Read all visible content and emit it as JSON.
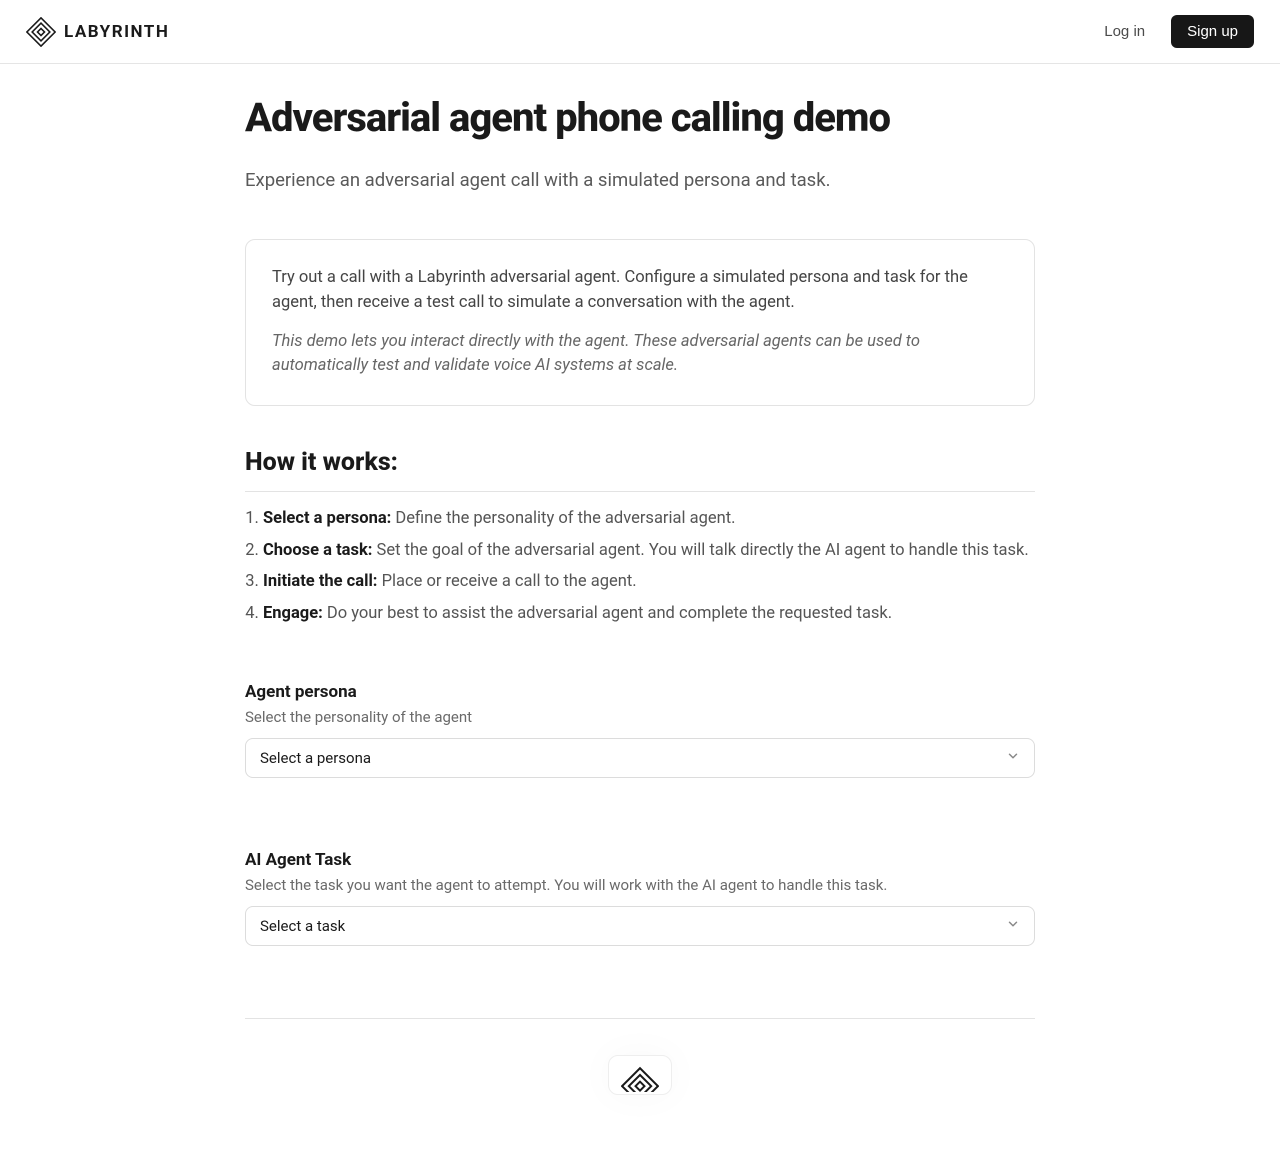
{
  "brand": {
    "name": "LABYRINTH"
  },
  "header": {
    "login_label": "Log in",
    "signup_label": "Sign up"
  },
  "page": {
    "title": "Adversarial agent phone calling demo",
    "subtitle": "Experience an adversarial agent call with a simulated persona and task.",
    "intro_main": "Try out a call with a Labyrinth adversarial agent. Configure a simulated persona and task for the agent, then receive a test call to simulate a conversation with the agent.",
    "intro_note": "This demo lets you interact directly with the agent. These adversarial agents can be used to automatically test and validate voice AI systems at scale.",
    "how_heading": "How it works:"
  },
  "steps": [
    {
      "label": "Select a persona:",
      "desc": "Define the personality of the adversarial agent."
    },
    {
      "label": "Choose a task:",
      "desc": "Set the goal of the adversarial agent. You will talk directly the AI agent to handle this task."
    },
    {
      "label": "Initiate the call:",
      "desc": "Place or receive a call to the agent."
    },
    {
      "label": "Engage:",
      "desc": "Do your best to assist the adversarial agent and complete the requested task."
    }
  ],
  "persona": {
    "label": "Agent persona",
    "desc": "Select the personality of the agent",
    "placeholder": "Select a persona"
  },
  "task": {
    "label": "AI Agent Task",
    "desc": "Select the task you want the agent to attempt. You will work with the AI agent to handle this task.",
    "placeholder": "Select a task"
  }
}
